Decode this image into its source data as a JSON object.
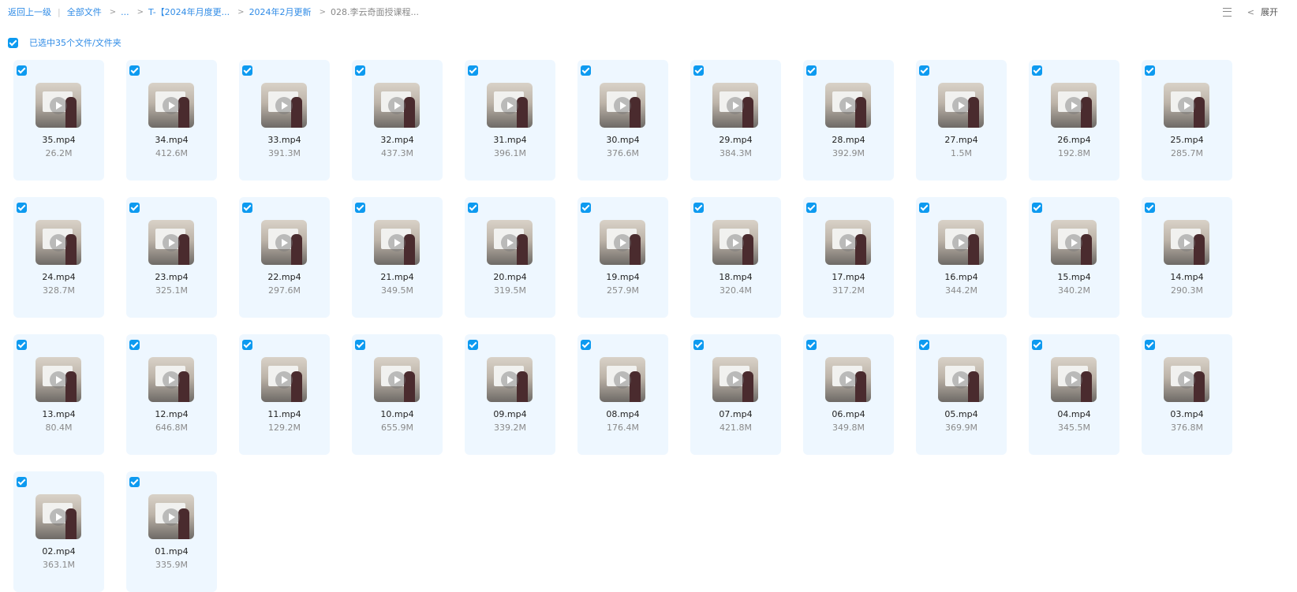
{
  "breadcrumb": {
    "back": "返回上一级",
    "all_files": "全部文件",
    "ellipsis": "...",
    "folder1": "T-【2024年月度更...",
    "folder2": "2024年2月更新",
    "current": "028.李云奇面授课程..."
  },
  "toolbar": {
    "list_icon": "list-view-icon",
    "chevron_icon": "chevron-left-icon",
    "expand_label": "展开"
  },
  "selection": {
    "text": "已选中35个文件/文件夹",
    "checked": true
  },
  "colors": {
    "accent": "#0d9af0",
    "link": "#2f8be6",
    "card_bg": "#eef7ff"
  },
  "files": [
    {
      "name": "35.mp4",
      "size": "26.2M"
    },
    {
      "name": "34.mp4",
      "size": "412.6M"
    },
    {
      "name": "33.mp4",
      "size": "391.3M"
    },
    {
      "name": "32.mp4",
      "size": "437.3M"
    },
    {
      "name": "31.mp4",
      "size": "396.1M"
    },
    {
      "name": "30.mp4",
      "size": "376.6M"
    },
    {
      "name": "29.mp4",
      "size": "384.3M"
    },
    {
      "name": "28.mp4",
      "size": "392.9M"
    },
    {
      "name": "27.mp4",
      "size": "1.5M"
    },
    {
      "name": "26.mp4",
      "size": "192.8M"
    },
    {
      "name": "25.mp4",
      "size": "285.7M"
    },
    {
      "name": "24.mp4",
      "size": "328.7M"
    },
    {
      "name": "23.mp4",
      "size": "325.1M"
    },
    {
      "name": "22.mp4",
      "size": "297.6M"
    },
    {
      "name": "21.mp4",
      "size": "349.5M"
    },
    {
      "name": "20.mp4",
      "size": "319.5M"
    },
    {
      "name": "19.mp4",
      "size": "257.9M"
    },
    {
      "name": "18.mp4",
      "size": "320.4M"
    },
    {
      "name": "17.mp4",
      "size": "317.2M"
    },
    {
      "name": "16.mp4",
      "size": "344.2M"
    },
    {
      "name": "15.mp4",
      "size": "340.2M"
    },
    {
      "name": "14.mp4",
      "size": "290.3M"
    },
    {
      "name": "13.mp4",
      "size": "80.4M"
    },
    {
      "name": "12.mp4",
      "size": "646.8M"
    },
    {
      "name": "11.mp4",
      "size": "129.2M"
    },
    {
      "name": "10.mp4",
      "size": "655.9M"
    },
    {
      "name": "09.mp4",
      "size": "339.2M"
    },
    {
      "name": "08.mp4",
      "size": "176.4M"
    },
    {
      "name": "07.mp4",
      "size": "421.8M"
    },
    {
      "name": "06.mp4",
      "size": "349.8M"
    },
    {
      "name": "05.mp4",
      "size": "369.9M"
    },
    {
      "name": "04.mp4",
      "size": "345.5M"
    },
    {
      "name": "03.mp4",
      "size": "376.8M"
    },
    {
      "name": "02.mp4",
      "size": "363.1M"
    },
    {
      "name": "01.mp4",
      "size": "335.9M"
    }
  ]
}
